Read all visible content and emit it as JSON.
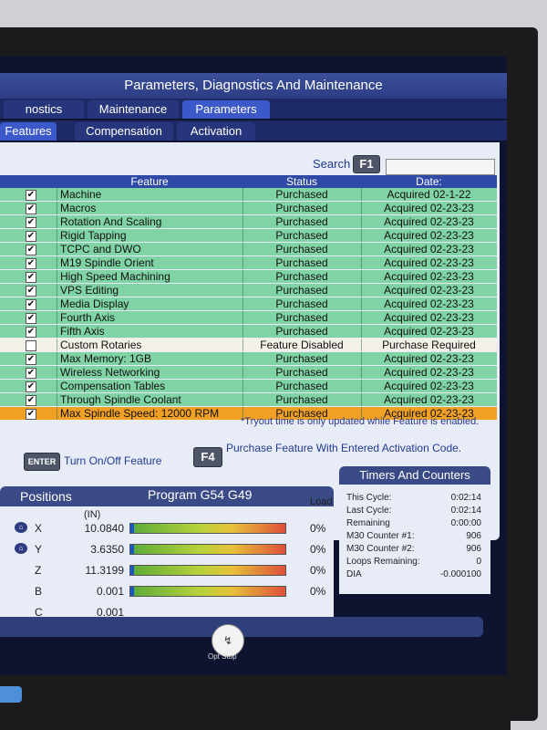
{
  "title": "Parameters, Diagnostics And Maintenance",
  "tabs_row1": [
    {
      "label": "nostics",
      "active": false
    },
    {
      "label": "Maintenance",
      "active": false
    },
    {
      "label": "Parameters",
      "active": true
    }
  ],
  "tabs_row2": [
    {
      "label": "Features",
      "active": true
    },
    {
      "label": "Compensation",
      "active": false
    },
    {
      "label": "Activation",
      "active": false
    }
  ],
  "search": {
    "label": "Search",
    "key": "F1",
    "value": ""
  },
  "table": {
    "headers": [
      "Feature",
      "Status",
      "Date:"
    ],
    "rows": [
      {
        "checked": true,
        "feature": "Machine",
        "status": "Purchased",
        "date": "Acquired 02-1-22",
        "state": "normal"
      },
      {
        "checked": true,
        "feature": "Macros",
        "status": "Purchased",
        "date": "Acquired 02-23-23",
        "state": "normal"
      },
      {
        "checked": true,
        "feature": "Rotation And Scaling",
        "status": "Purchased",
        "date": "Acquired 02-23-23",
        "state": "normal"
      },
      {
        "checked": true,
        "feature": "Rigid Tapping",
        "status": "Purchased",
        "date": "Acquired 02-23-23",
        "state": "normal"
      },
      {
        "checked": true,
        "feature": "TCPC and DWO",
        "status": "Purchased",
        "date": "Acquired 02-23-23",
        "state": "normal"
      },
      {
        "checked": true,
        "feature": "M19 Spindle Orient",
        "status": "Purchased",
        "date": "Acquired 02-23-23",
        "state": "normal"
      },
      {
        "checked": true,
        "feature": "High Speed Machining",
        "status": "Purchased",
        "date": "Acquired 02-23-23",
        "state": "normal"
      },
      {
        "checked": true,
        "feature": "VPS Editing",
        "status": "Purchased",
        "date": "Acquired 02-23-23",
        "state": "normal"
      },
      {
        "checked": true,
        "feature": "Media Display",
        "status": "Purchased",
        "date": "Acquired 02-23-23",
        "state": "normal"
      },
      {
        "checked": true,
        "feature": "Fourth Axis",
        "status": "Purchased",
        "date": "Acquired 02-23-23",
        "state": "normal"
      },
      {
        "checked": true,
        "feature": "Fifth Axis",
        "status": "Purchased",
        "date": "Acquired 02-23-23",
        "state": "normal"
      },
      {
        "checked": false,
        "feature": "Custom Rotaries",
        "status": "Feature Disabled",
        "date": "Purchase Required",
        "state": "disabled"
      },
      {
        "checked": true,
        "feature": "Max Memory: 1GB",
        "status": "Purchased",
        "date": "Acquired 02-23-23",
        "state": "normal"
      },
      {
        "checked": true,
        "feature": "Wireless Networking",
        "status": "Purchased",
        "date": "Acquired 02-23-23",
        "state": "normal"
      },
      {
        "checked": true,
        "feature": "Compensation Tables",
        "status": "Purchased",
        "date": "Acquired 02-23-23",
        "state": "normal"
      },
      {
        "checked": true,
        "feature": "Through Spindle Coolant",
        "status": "Purchased",
        "date": "Acquired 02-23-23",
        "state": "normal"
      },
      {
        "checked": true,
        "feature": "Max Spindle Speed: 12000 RPM",
        "status": "Purchased",
        "date": "Acquired 02-23-23",
        "state": "selected"
      }
    ]
  },
  "note": "*Tryout time is only updated while Feature is enabled.",
  "actions": {
    "enter_key": "ENTER",
    "enter_label": "Turn On/Off Feature",
    "f4_key": "F4",
    "f4_label": "Purchase Feature With Entered Activation Code."
  },
  "positions": {
    "title": "Positions",
    "program": "Program G54 G49",
    "units": "(IN)",
    "load_header": "Load",
    "axes": [
      {
        "axis": "X",
        "value": "10.0840",
        "load": "0%",
        "icon": true
      },
      {
        "axis": "Y",
        "value": "3.6350",
        "load": "0%",
        "icon": true
      },
      {
        "axis": "Z",
        "value": "11.3199",
        "load": "0%",
        "icon": false
      },
      {
        "axis": "B",
        "value": "0.001",
        "load": "0%",
        "icon": false
      },
      {
        "axis": "C",
        "value": "0.001",
        "load": "",
        "icon": false
      }
    ]
  },
  "timers": {
    "title": "Timers And Counters",
    "rows": [
      {
        "label": "This Cycle:",
        "value": "0:02:14"
      },
      {
        "label": "Last Cycle:",
        "value": "0:02:14"
      },
      {
        "label": "Remaining",
        "value": "0:00:00"
      },
      {
        "label": "M30 Counter #1:",
        "value": "906"
      },
      {
        "label": "M30 Counter #2:",
        "value": "906"
      },
      {
        "label": "Loops Remaining:",
        "value": "0"
      },
      {
        "label": "DIA",
        "value": "-0.000100"
      }
    ]
  },
  "opt_stop": {
    "label": "Opt Stop"
  },
  "colors": {
    "row_green": "#7fd3a4",
    "row_selected": "#f0a025",
    "header_blue": "#2f4aa6"
  }
}
